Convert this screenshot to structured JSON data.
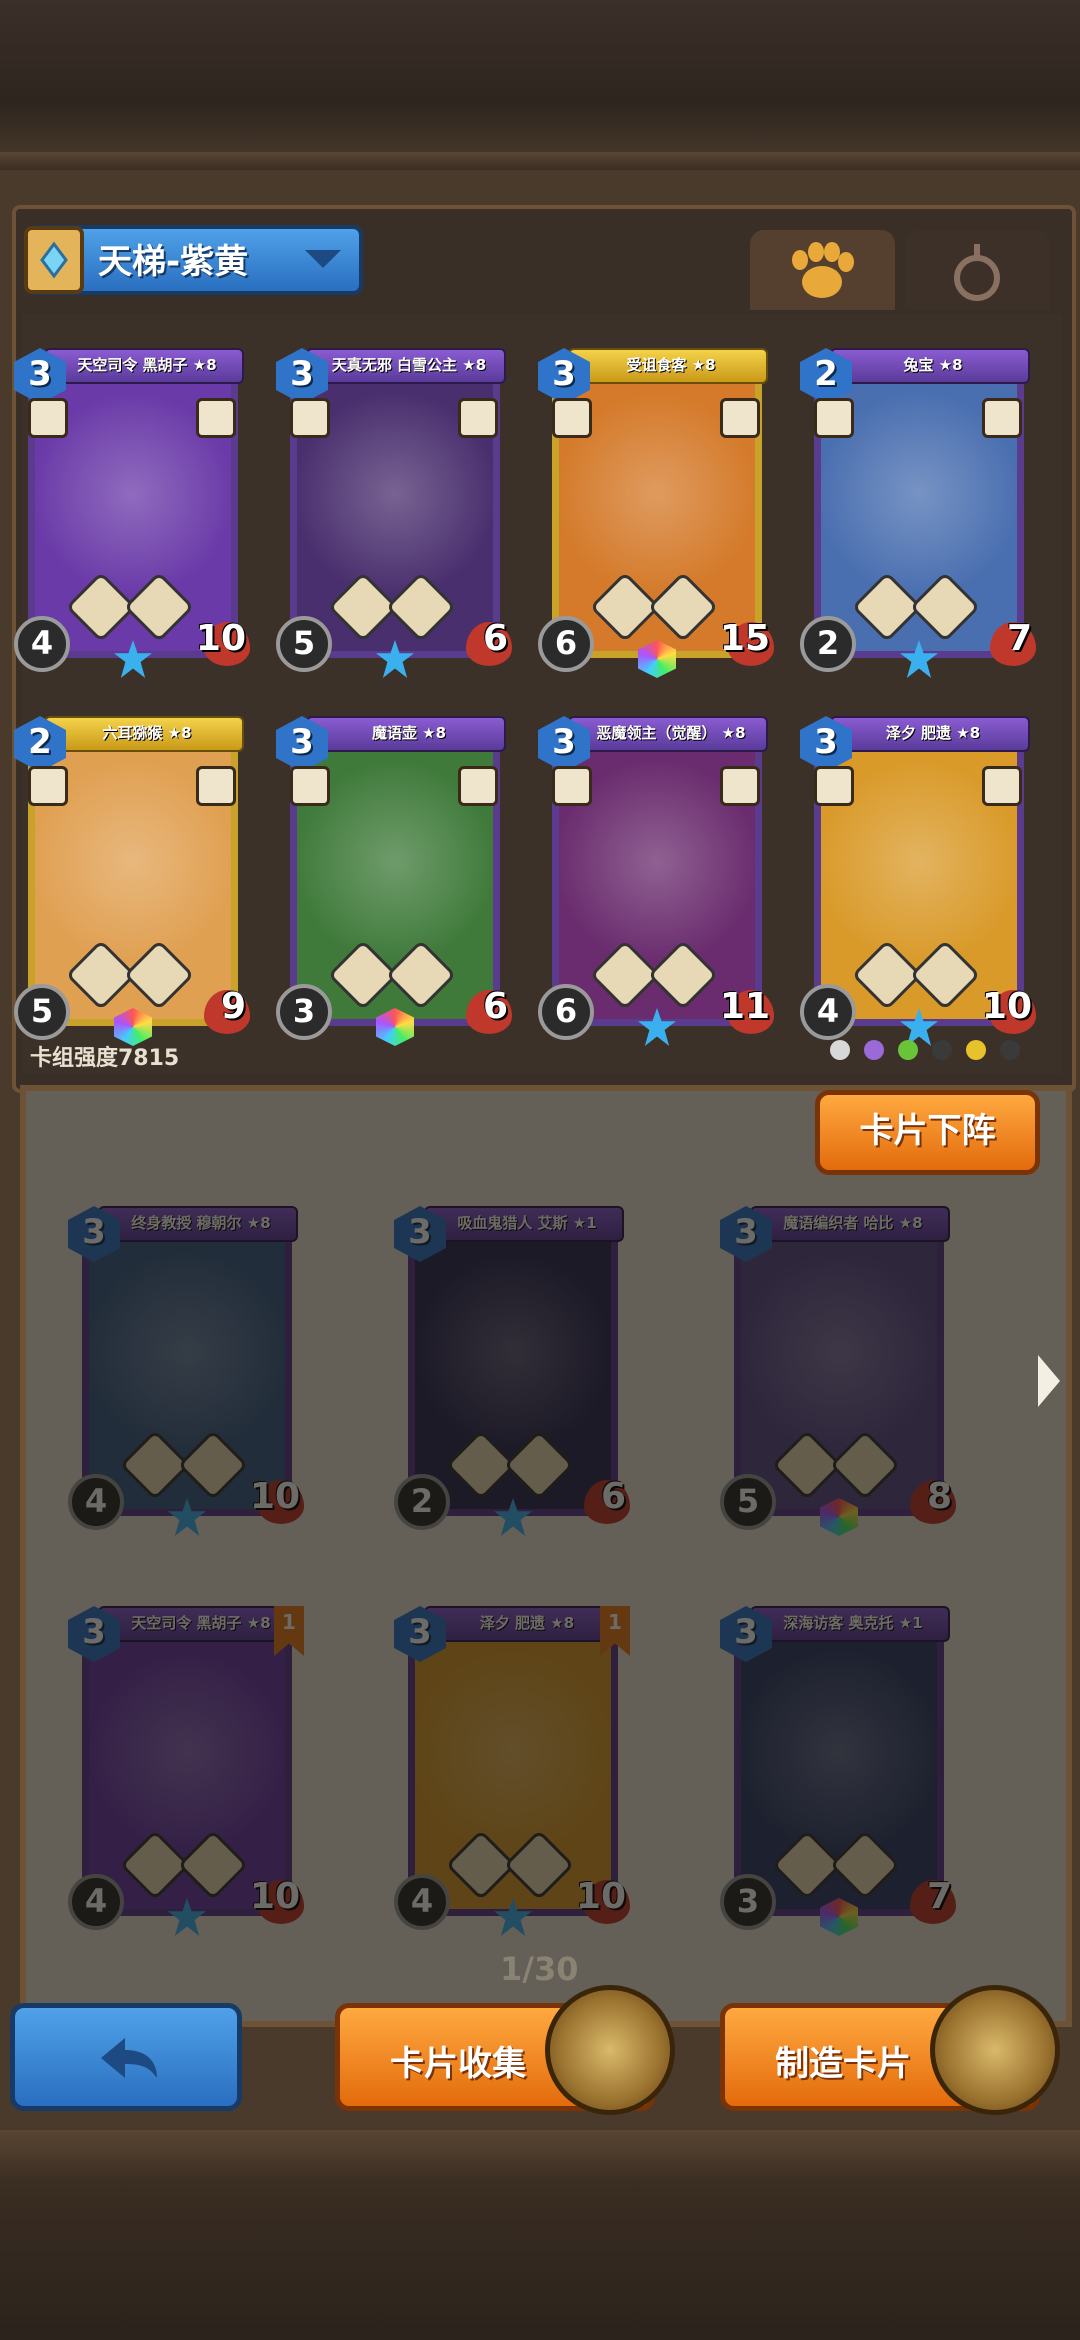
{
  "deck": {
    "name": "天梯-紫黄"
  },
  "tabs": [
    {
      "icon": "paw-icon"
    },
    {
      "icon": "potion-icon"
    }
  ],
  "deck_power": "卡组强度7815",
  "deck_cards": [
    {
      "title": "天空司令 黑胡子 ★8",
      "cost": "3",
      "atk": "4",
      "hp": "10",
      "frame": "#5a3b8e",
      "art": "#6a3aa8",
      "gold": false,
      "extra": "4",
      "skills": [
        "",
        ""
      ],
      "left_badge": "2"
    },
    {
      "title": "天真无邪 白雪公主 ★8",
      "cost": "3",
      "atk": "5",
      "hp": "6",
      "frame": "#5a3b8e",
      "art": "#4a2f6e",
      "gold": false,
      "extra": "",
      "skills": [
        "1",
        ""
      ],
      "left_badge": "2"
    },
    {
      "title": "受诅食客 ★8",
      "cost": "3",
      "atk": "6",
      "hp": "15",
      "frame": "#c9a22a",
      "art": "#d47a2a",
      "gold": true,
      "extra": "",
      "skills": [
        "1",
        "2"
      ],
      "left_badge": ""
    },
    {
      "title": "兔宝 ★8",
      "cost": "2",
      "atk": "2",
      "hp": "7",
      "frame": "#5a3b8e",
      "art": "#4a6fb0",
      "gold": false,
      "extra": "1",
      "skills": [
        "",
        ""
      ],
      "left_badge": ""
    },
    {
      "title": "六耳猕猴 ★8",
      "cost": "2",
      "atk": "5",
      "hp": "9",
      "frame": "#c9a22a",
      "art": "#e0a052",
      "gold": true,
      "extra": "",
      "skills": [
        "",
        "1"
      ],
      "left_badge": ""
    },
    {
      "title": "魔语壶 ★8",
      "cost": "3",
      "atk": "3",
      "hp": "6",
      "frame": "#5a3b8e",
      "art": "#3f7a3a",
      "gold": false,
      "extra": "4",
      "skills": [
        "1",
        "1"
      ],
      "left_badge": ""
    },
    {
      "title": "恶魔领主（觉醒） ★8",
      "cost": "3",
      "atk": "6",
      "hp": "11",
      "frame": "#5a3b8e",
      "art": "#6a2c6e",
      "gold": false,
      "extra": "",
      "skills": [
        "2",
        ""
      ],
      "left_badge": ""
    },
    {
      "title": "泽夕 肥遗 ★8",
      "cost": "3",
      "atk": "4",
      "hp": "10",
      "frame": "#5a3b8e",
      "art": "#d99a2a",
      "gold": false,
      "extra": "",
      "skills": [
        "3",
        "1"
      ],
      "left_badge": ""
    }
  ],
  "collection_cards": [
    {
      "title": "终身教授 穆朝尔 ★8",
      "cost": "3",
      "atk": "4",
      "hp": "10",
      "art": "#3b5d88",
      "extra": "",
      "flag": ""
    },
    {
      "title": "吸血鬼猎人 艾斯 ★1",
      "cost": "3",
      "atk": "2",
      "hp": "6",
      "art": "#2c2a55",
      "extra": "2",
      "flag": ""
    },
    {
      "title": "魔语编织者 哈比 ★8",
      "cost": "3",
      "atk": "5",
      "hp": "8",
      "art": "#5a4a8a",
      "extra": "",
      "flag": ""
    },
    {
      "title": "天空司令 黑胡子 ★8",
      "cost": "3",
      "atk": "4",
      "hp": "10",
      "art": "#6a3aa8",
      "extra": "4",
      "flag": "1"
    },
    {
      "title": "泽夕 肥遗 ★8",
      "cost": "3",
      "atk": "4",
      "hp": "10",
      "art": "#d99a2a",
      "extra": "",
      "flag": "1"
    },
    {
      "title": "深海访客 奥克托 ★1",
      "cost": "3",
      "atk": "3",
      "hp": "7",
      "art": "#2f3e6a",
      "extra": "",
      "flag": ""
    }
  ],
  "buttons": {
    "unequip": "卡片下阵",
    "back": "back-arrow-icon",
    "collect": "卡片收集",
    "craft": "制造卡片"
  },
  "pagination": "1/30",
  "legend_colors": [
    "#d8d8d8",
    "#9a6ad8",
    "#6ac43a",
    "#3a3a3a",
    "#e8c22a",
    "#3a3a3a"
  ]
}
